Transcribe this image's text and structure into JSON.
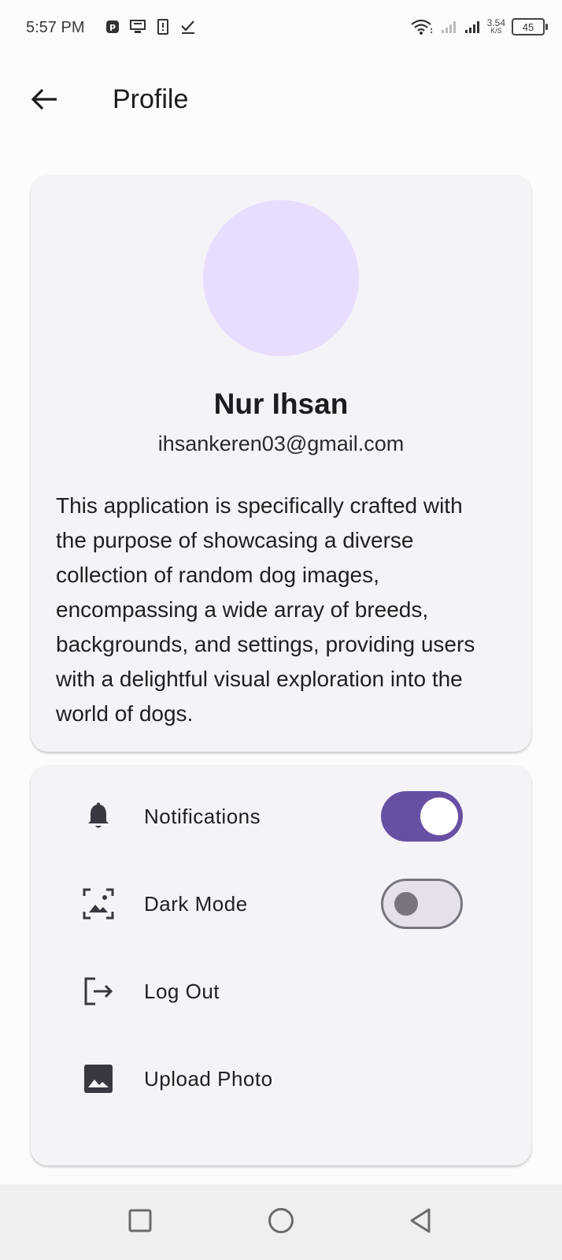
{
  "status_bar": {
    "time": "5:57 PM",
    "net_speed_value": "3.54",
    "net_speed_unit": "K/S",
    "battery": "45",
    "left_icons": [
      "app-icon",
      "desktop-icon",
      "sim-icon",
      "check-icon"
    ],
    "right_icons": [
      "wifi-icon",
      "signal-icon",
      "signal-icon"
    ]
  },
  "app_bar": {
    "title": "Profile",
    "back_icon": "arrow-left-icon"
  },
  "profile": {
    "name": "Nur Ihsan",
    "email": "ihsankeren03@gmail.com",
    "description": "This application is specifically crafted with the purpose of showcasing a diverse collection of random dog images, encompassing a wide array of breeds, backgrounds, and settings, providing users with a delightful visual exploration into the world of dogs.",
    "avatar_color": "#e8ddff"
  },
  "settings": {
    "items": [
      {
        "label": "Notifications",
        "icon": "bell-icon",
        "toggle": true
      },
      {
        "label": "Dark Mode",
        "icon": "image-frame-icon",
        "toggle": false
      },
      {
        "label": "Log Out",
        "icon": "logout-icon"
      },
      {
        "label": "Upload Photo",
        "icon": "photo-icon"
      }
    ]
  },
  "colors": {
    "accent": "#6750a4",
    "card_bg": "#f5f2f8",
    "page_bg": "#fefbff",
    "switch_off_track": "#e6e0ea",
    "switch_off_outline": "#79747e"
  },
  "nav_bar": {
    "buttons": [
      "recents-square-icon",
      "home-circle-icon",
      "back-triangle-icon"
    ]
  }
}
